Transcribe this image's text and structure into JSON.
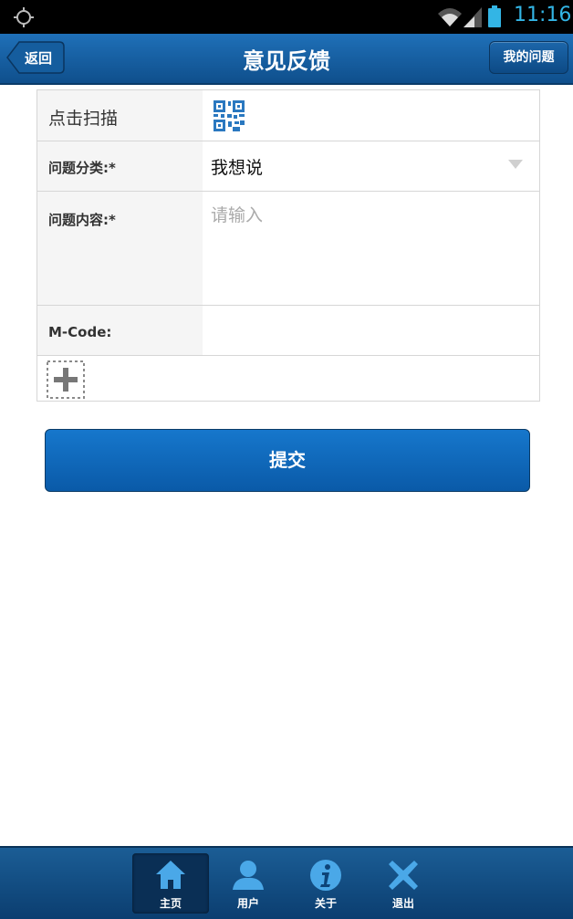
{
  "status_bar": {
    "time": "11:16"
  },
  "header": {
    "back_label": "返回",
    "title": "意见反馈",
    "my_questions_label": "我的问题"
  },
  "form": {
    "scan_label": "点击扫描",
    "category_label": "问题分类:*",
    "category_value": "我想说",
    "content_label": "问题内容:*",
    "content_placeholder": "请输入",
    "mcode_label": "M-Code:",
    "mcode_value": ""
  },
  "submit_label": "提交",
  "tabs": [
    {
      "label": "主页",
      "icon": "home-icon",
      "active": true
    },
    {
      "label": "用户",
      "icon": "user-icon",
      "active": false
    },
    {
      "label": "关于",
      "icon": "info-icon",
      "active": false
    },
    {
      "label": "退出",
      "icon": "close-icon",
      "active": false
    }
  ],
  "colors": {
    "header": "#1566ad",
    "accent": "#33b5e5",
    "button": "#0f66b8",
    "tab_icon": "#4aa8e8"
  }
}
